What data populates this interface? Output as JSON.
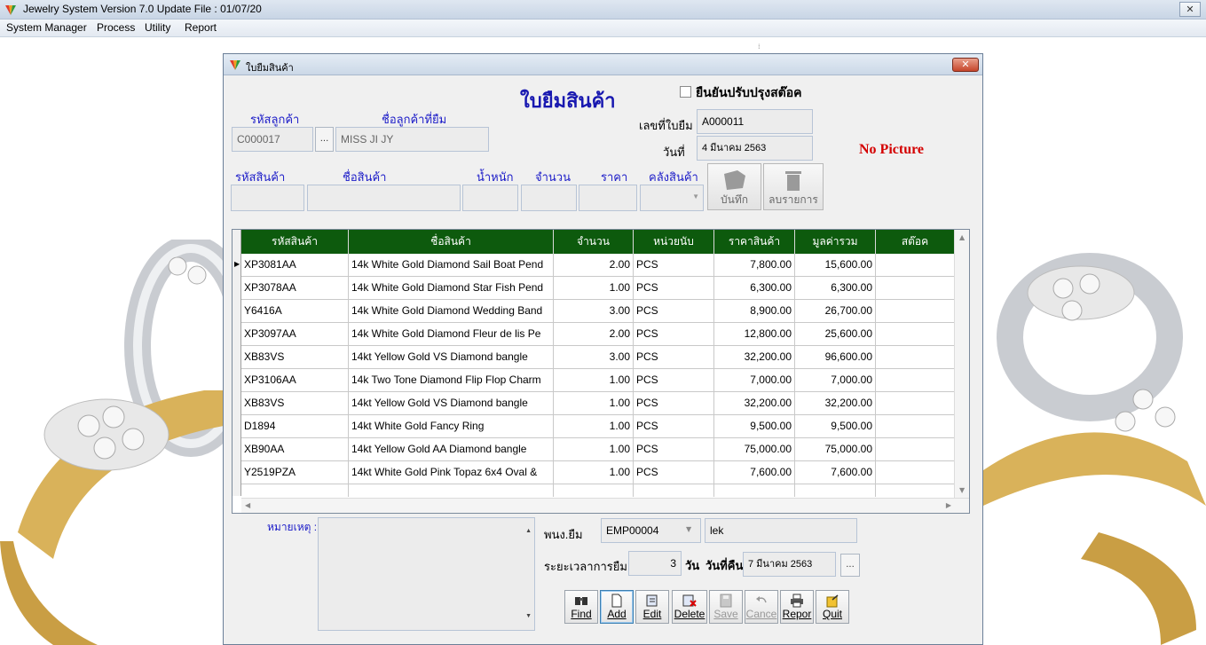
{
  "app": {
    "title": "Jewelry System Version 7.0 Update File : 01/07/20",
    "menus": [
      "System Manager",
      "Process",
      "Utility",
      "Report"
    ]
  },
  "dialog": {
    "title": "ใบยืมสินค้า",
    "heading": "ใบยืมสินค้า",
    "confirm_stock_label": "ยืนยันปรับปรุงสต๊อค",
    "confirm_stock_checked": false,
    "customer_code_label": "รหัสลูกค้า",
    "customer_code": "C000017",
    "customer_name_label": "ชื่อลูกค้าที่ยืม",
    "customer_name": "MISS  JI  JY",
    "loan_no_label": "เลขที่ใบยืม",
    "loan_no": "A000011",
    "date_label": "วันที่",
    "date": "4 มีนาคม 2563",
    "no_picture": "No Picture",
    "item_labels": {
      "code": "รหัสสินค้า",
      "name": "ชื่อสินค้า",
      "weight": "น้ำหนัก",
      "qty": "จำนวน",
      "price": "ราคา",
      "warehouse": "คลังสินค้า"
    },
    "item_buttons": {
      "save": "บันทึก",
      "delete": "ลบรายการ"
    },
    "grid": {
      "columns": [
        "รหัสสินค้า",
        "ชื่อสินค้า",
        "จำนวน",
        "หน่วยนับ",
        "ราคาสินค้า",
        "มูลค่ารวม",
        "สต๊อค"
      ],
      "rows": [
        [
          "XP3081AA",
          "14k White Gold Diamond Sail Boat Pend",
          "2.00",
          "PCS",
          "7,800.00",
          "15,600.00",
          ""
        ],
        [
          "XP3078AA",
          "14k White Gold Diamond Star Fish Pend",
          "1.00",
          "PCS",
          "6,300.00",
          "6,300.00",
          ""
        ],
        [
          "Y6416A",
          "14k White Gold Diamond Wedding Band",
          "3.00",
          "PCS",
          "8,900.00",
          "26,700.00",
          ""
        ],
        [
          "XP3097AA",
          "14k White Gold Diamond Fleur de lis Pe",
          "2.00",
          "PCS",
          "12,800.00",
          "25,600.00",
          ""
        ],
        [
          "XB83VS",
          "14kt Yellow Gold VS Diamond bangle",
          "3.00",
          "PCS",
          "32,200.00",
          "96,600.00",
          ""
        ],
        [
          "XP3106AA",
          "14k Two Tone Diamond Flip Flop Charm",
          "1.00",
          "PCS",
          "7,000.00",
          "7,000.00",
          ""
        ],
        [
          "XB83VS",
          "14kt Yellow Gold VS Diamond bangle",
          "1.00",
          "PCS",
          "32,200.00",
          "32,200.00",
          ""
        ],
        [
          "D1894",
          "14kt White Gold Fancy Ring",
          "1.00",
          "PCS",
          "9,500.00",
          "9,500.00",
          ""
        ],
        [
          "XB90AA",
          "14kt Yellow Gold AA Diamond bangle",
          "1.00",
          "PCS",
          "75,000.00",
          "75,000.00",
          ""
        ],
        [
          "Y2519PZA",
          "14kt White Gold Pink Topaz 6x4 Oval &",
          "1.00",
          "PCS",
          "7,600.00",
          "7,600.00",
          ""
        ]
      ]
    },
    "remark_label": "หมายเหตุ :",
    "employee_label": "พนง.ยืม",
    "employee_code": "EMP00004",
    "employee_name": "lek",
    "duration_label": "ระยะเวลาการยืม",
    "duration_days": "3",
    "day_unit": "วัน",
    "return_date_label": "วันที่คืน",
    "return_date": "7 มีนาคม 2563",
    "actions": {
      "find": "Find",
      "add": "Add",
      "edit": "Edit",
      "delete": "Delete",
      "save": "Save",
      "cancel": "Cance",
      "report": "Repor",
      "quit": "Quit"
    }
  }
}
